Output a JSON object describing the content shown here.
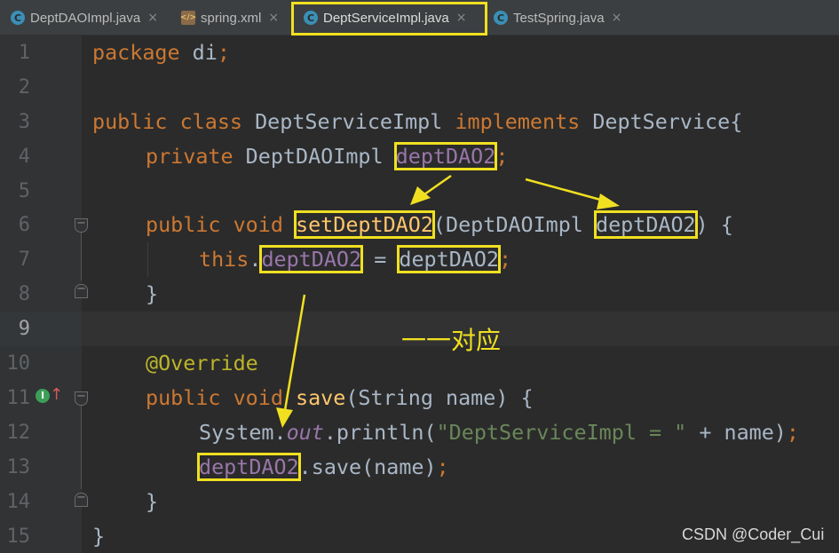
{
  "tabs": [
    {
      "label": "DeptDAOImpl.java",
      "icon": "java-class-icon",
      "icon_glyph": "C",
      "close": "×"
    },
    {
      "label": "spring.xml",
      "icon": "xml-file-icon",
      "icon_glyph": "</>",
      "close": "×"
    },
    {
      "label": "DeptServiceImpl.java",
      "icon": "java-class-icon",
      "icon_glyph": "C",
      "close": "×"
    },
    {
      "label": "TestSpring.java",
      "icon": "java-class-icon",
      "icon_glyph": "C",
      "close": "×"
    }
  ],
  "active_tab": "DeptServiceImpl.java",
  "line_numbers": [
    "1",
    "2",
    "3",
    "4",
    "5",
    "6",
    "7",
    "8",
    "9",
    "10",
    "11",
    "12",
    "13",
    "14",
    "15"
  ],
  "current_line": "9",
  "code": {
    "l1": {
      "kw": "package",
      "pkg": " di",
      "semi": ";"
    },
    "l3": {
      "kw1": "public class",
      "name": " DeptServiceImpl ",
      "kw2": "implements",
      "iface": " DeptService{"
    },
    "l4": {
      "kw": "private",
      "type": " DeptDAOImpl ",
      "field": "deptDAO2",
      "semi": ";"
    },
    "l6": {
      "kw": "public void ",
      "method": "setDeptDAO2",
      "params": "(DeptDAOImpl ",
      "param": "deptDAO2",
      "rest": ") {"
    },
    "l7": {
      "kw": "this",
      "dot": ".",
      "field": "deptDAO2",
      "eq": " = ",
      "param": "deptDAO2",
      "semi": ";"
    },
    "l8": {
      "brace": "}"
    },
    "l10": {
      "annotation": "@Override"
    },
    "l11": {
      "kw": "public void ",
      "method": "save",
      "params": "(String name) {"
    },
    "l12": {
      "cls": "System.",
      "static_field": "out",
      "call": ".println(",
      "str": "\"DeptServiceImpl = \"",
      "rest": " + name)",
      "semi": ";"
    },
    "l13": {
      "field": "deptDAO2",
      "call": ".save(name)",
      "semi": ";"
    },
    "l14": {
      "brace": "}"
    },
    "l15": {
      "brace": "}"
    }
  },
  "gutter_icons": {
    "implements": "I",
    "arrow": "↑"
  },
  "fold_glyph": "−",
  "note": "一一对应",
  "watermark": "CSDN @Coder_Cui",
  "colors": {
    "keyword": "#cc7832",
    "field": "#9876aa",
    "method": "#ffc66d",
    "string": "#6a8759",
    "annotation": "#bbb529",
    "highlight": "#f0e020",
    "background": "#2b2b2b"
  }
}
